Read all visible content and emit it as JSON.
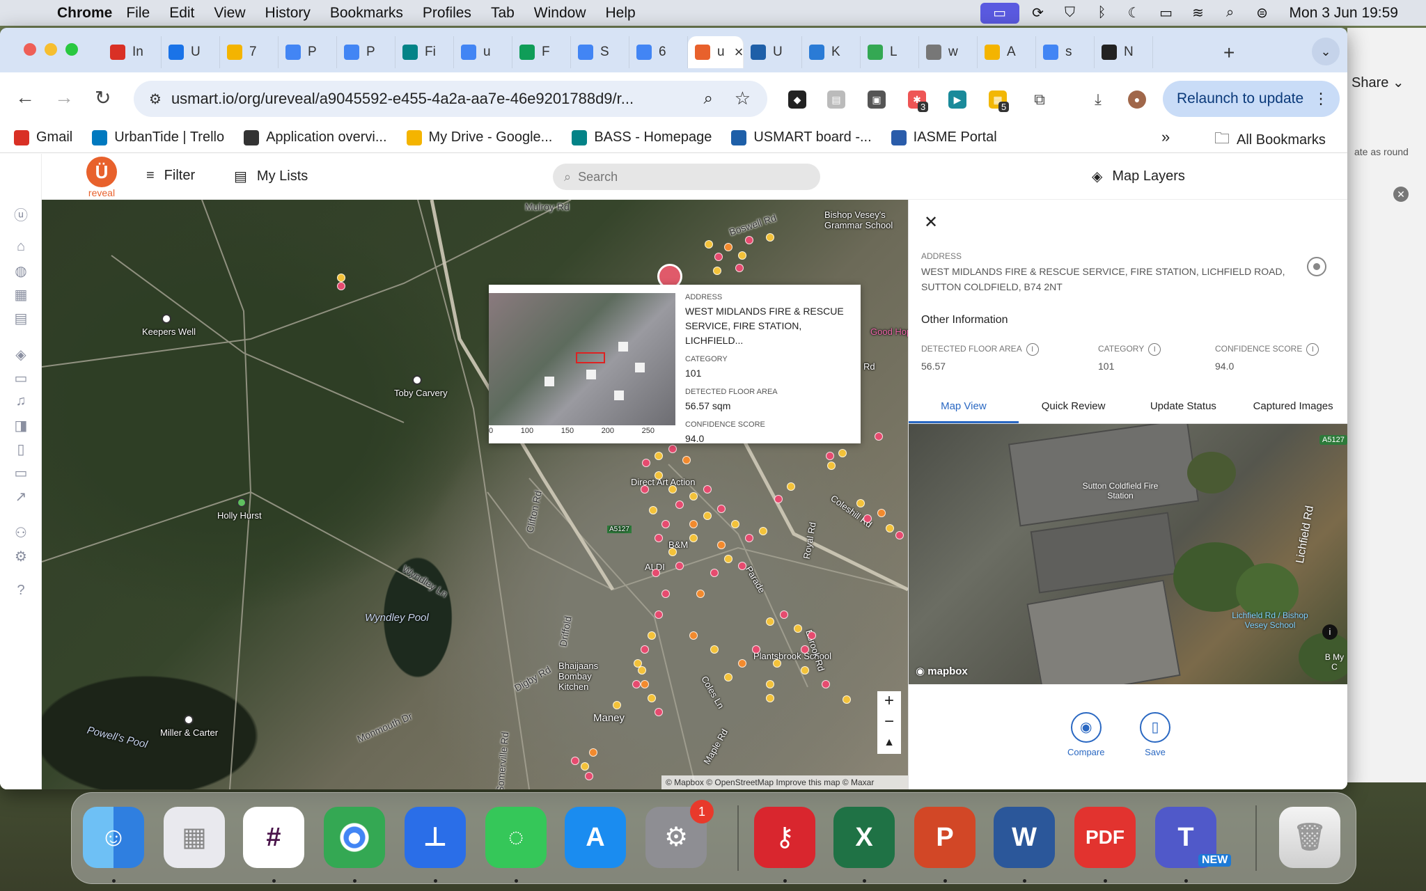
{
  "menubar": {
    "app_name": "Chrome",
    "items": [
      "File",
      "Edit",
      "View",
      "History",
      "Bookmarks",
      "Profiles",
      "Tab",
      "Window",
      "Help"
    ],
    "clock": "Mon 3 Jun  19:59"
  },
  "browser": {
    "tabs": [
      {
        "favicon": "gmail-icon",
        "title": "In"
      },
      {
        "favicon": "calendar-icon",
        "title": "U"
      },
      {
        "favicon": "google-drive-icon",
        "title": "7"
      },
      {
        "favicon": "google-docs-icon",
        "title": "P"
      },
      {
        "favicon": "google-docs-icon",
        "title": "P"
      },
      {
        "favicon": "sharepoint-icon",
        "title": "Fi"
      },
      {
        "favicon": "google-docs-icon",
        "title": "u"
      },
      {
        "favicon": "google-sheets-icon",
        "title": "F"
      },
      {
        "favicon": "google-docs-icon",
        "title": "S"
      },
      {
        "favicon": "google-docs-icon",
        "title": "6"
      },
      {
        "favicon": "usmart-icon",
        "title": "u",
        "active": true
      },
      {
        "favicon": "usmart-board-icon",
        "title": "U"
      },
      {
        "favicon": "kumu-icon",
        "title": "K"
      },
      {
        "favicon": "google-maps-icon",
        "title": "L"
      },
      {
        "favicon": "globe-icon",
        "title": "w"
      },
      {
        "favicon": "maps-pin-icon",
        "title": "A"
      },
      {
        "favicon": "google-icon",
        "title": "s"
      },
      {
        "favicon": "github-icon",
        "title": "N"
      }
    ],
    "url": "usmart.io/org/ureveal/a9045592-e455-4a2a-aa7e-46e9201788d9/r...",
    "relaunch_label": "Relaunch to update",
    "extension_badges": {
      "first": "3",
      "second": "5"
    },
    "bookmarks": [
      {
        "favicon": "gmail-icon",
        "label": "Gmail"
      },
      {
        "favicon": "trello-icon",
        "label": "UrbanTide | Trello"
      },
      {
        "favicon": "app-overview-icon",
        "label": "Application overvi..."
      },
      {
        "favicon": "google-drive-icon",
        "label": "My Drive - Google..."
      },
      {
        "favicon": "sharepoint-icon",
        "label": "BASS - Homepage"
      },
      {
        "favicon": "usmart-board-icon",
        "label": "USMART board -..."
      },
      {
        "favicon": "iasme-icon",
        "label": "IASME Portal"
      }
    ],
    "all_bookmarks_label": "All Bookmarks"
  },
  "app": {
    "logo_text": "reveal",
    "filter_label": "Filter",
    "mylists_label": "My Lists",
    "search_placeholder": "Search",
    "maplayers_label": "Map Layers"
  },
  "map": {
    "labels": {
      "mulroy": "Mulroy Rd",
      "boswell": "Boswell Rd",
      "bishop": "Bishop Vesey's Grammar School",
      "keepers": "Keepers Well",
      "toby": "Toby Carvery",
      "holly": "Holly Hurst",
      "wyndley_ln": "Wyndley Ln",
      "wyndley_pool": "Wyndley Pool",
      "powells": "Powell's Pool",
      "miller": "Miller & Carter",
      "clifton": "Clifton Rd",
      "driffold": "Driffold",
      "digby": "Digby Rd",
      "monmouth": "Monmouth Dr",
      "somerville": "Somerville Rd",
      "maney": "Maney",
      "bhaijaans": "Bhaijaans Bombay Kitchen",
      "direct": "Direct Art Action",
      "bm": "B&M",
      "aldi": "ALDI",
      "coleshill": "Coleshill Rd",
      "royal": "Royal Rd",
      "parade": "Parade",
      "plantsbrook": "Plantsbrook School",
      "ebrook": "Ebrook Rd",
      "coles": "Coles Ln",
      "maple": "Maple Rd",
      "a5127": "A5127",
      "good_hope": "Good Hop",
      "rd": "Rd"
    },
    "attribution": "© Mapbox © OpenStreetMap  Improve this map  © Maxar",
    "popup": {
      "scale_ticks": [
        "0",
        "100",
        "150",
        "200",
        "250"
      ],
      "address_label": "ADDRESS",
      "address": "WEST MIDLANDS FIRE & RESCUE SERVICE, FIRE STATION, LICHFIELD...",
      "category_label": "CATEGORY",
      "category": "101",
      "floor_label": "DETECTED FLOOR AREA",
      "floor": "56.57 sqm",
      "confidence_label": "CONFIDENCE SCORE",
      "confidence": "94.0"
    },
    "dot_colors": {
      "yellow": "#f3c23a",
      "pink": "#e64b6f",
      "orange": "#f28a2e"
    }
  },
  "panel": {
    "address_label": "ADDRESS",
    "address": "WEST MIDLANDS FIRE & RESCUE SERVICE, FIRE STATION, LICHFIELD ROAD, SUTTON COLDFIELD, B74 2NT",
    "other_info": "Other Information",
    "fields": [
      {
        "label": "DETECTED FLOOR AREA",
        "value": "56.57"
      },
      {
        "label": "CATEGORY",
        "value": "101"
      },
      {
        "label": "CONFIDENCE SCORE",
        "value": "94.0"
      }
    ],
    "tabs": [
      "Map View",
      "Quick Review",
      "Update Status",
      "Captured Images"
    ],
    "aerial": {
      "fire_station": "Sutton Coldfield Fire Station",
      "lichfield": "Lichfield Rd",
      "bus_stop": "Lichfield Rd / Bishop Vesey School",
      "b_my": "B My C",
      "shield": "A5127",
      "mapbox": "mapbox"
    },
    "compare_label": "Compare",
    "save_label": "Save"
  },
  "background_window": {
    "share_label": "Share",
    "snippet": "ate as round"
  },
  "dock": {
    "apps": [
      "finder-icon",
      "launchpad-icon",
      "slack-icon",
      "chrome-icon",
      "keynote-icon",
      "messages-icon",
      "app-store-icon",
      "system-settings-icon",
      "password-manager-icon",
      "excel-icon",
      "powerpoint-icon",
      "word-icon",
      "pdf-icon",
      "teams-icon",
      "trash-icon"
    ],
    "settings_badge": "1",
    "teams_tag": "NEW"
  },
  "colors": {
    "accent_blue": "#2a68c2",
    "brand_orange": "#e8612c",
    "mac_menubar": "#dfe3ea"
  }
}
